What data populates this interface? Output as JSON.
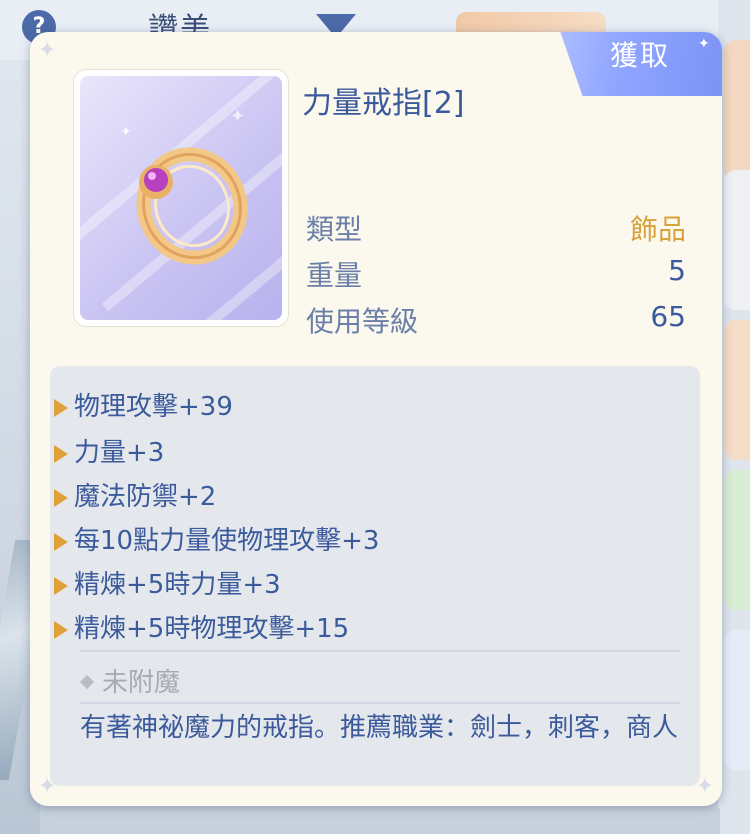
{
  "background": {
    "help_icon": "?",
    "title": "讚美"
  },
  "panel": {
    "acquire_label": "獲取",
    "item_name": "力量戒指[2]",
    "item_icon": "ring-icon",
    "stats": [
      {
        "label": "類型",
        "value": "飾品",
        "color": "#d8a23a"
      },
      {
        "label": "重量",
        "value": "5",
        "color": "#3b5a9c"
      },
      {
        "label": "使用等級",
        "value": "65",
        "color": "#3b5a9c"
      }
    ],
    "effects": [
      "物理攻擊+39",
      "力量+3",
      "魔法防禦+2",
      "每10點力量使物理攻擊+3",
      "精煉+5時力量+3",
      "精煉+5時物理攻擊+15"
    ],
    "enchant": "未附魔",
    "description": "有著神祕魔力的戒指。推薦職業：劍士，刺客，商人"
  },
  "colors": {
    "accent_blue": "#3b5a9c",
    "label_blue": "#6b7fa8",
    "gold": "#d8a23a",
    "bullet": "#e0a13a",
    "tab": "#8fa5ff"
  }
}
